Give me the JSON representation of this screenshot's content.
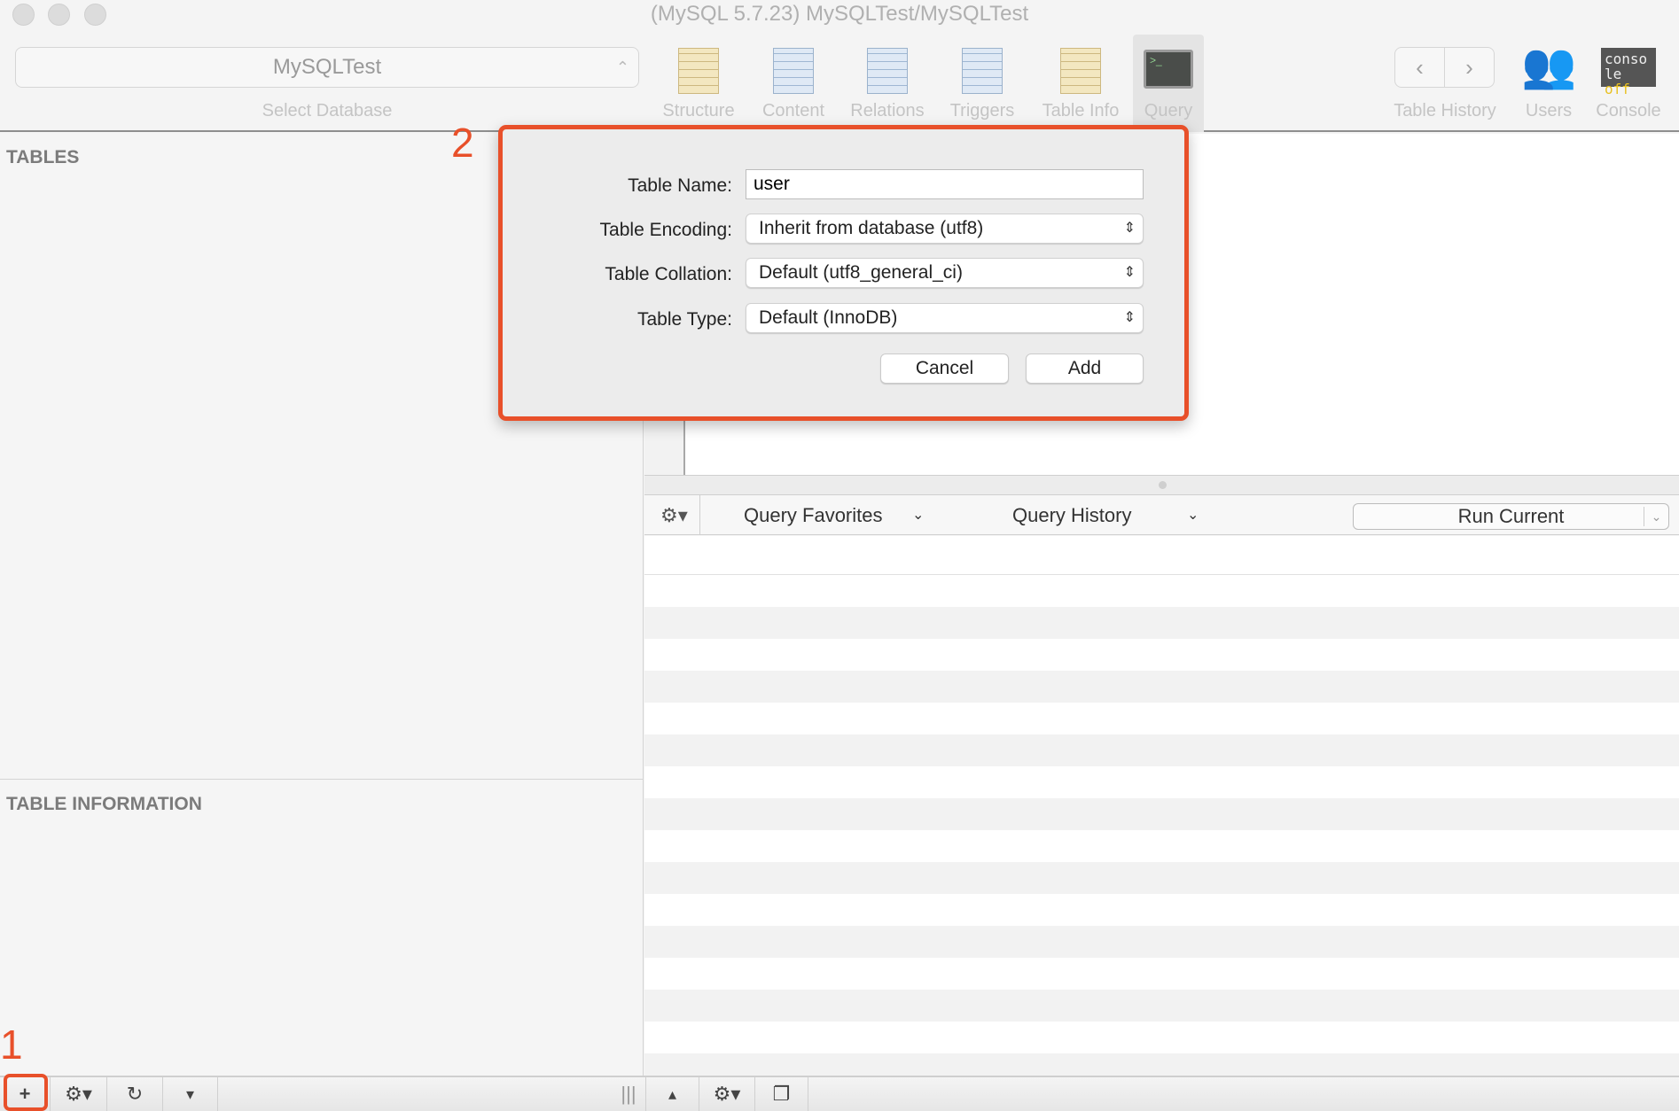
{
  "window": {
    "title": "(MySQL 5.7.23) MySQLTest/MySQLTest"
  },
  "toolbar": {
    "database": {
      "value": "MySQLTest",
      "label": "Select Database"
    },
    "views": [
      {
        "label": "Structure"
      },
      {
        "label": "Content"
      },
      {
        "label": "Relations"
      },
      {
        "label": "Triggers"
      },
      {
        "label": "Table Info"
      },
      {
        "label": "Query",
        "active": true
      }
    ],
    "table_history_label": "Table History",
    "users_label": "Users",
    "console_label": "Console",
    "console_icon_text": {
      "line1": "conso",
      "line2a": "le ",
      "line2b": "off"
    }
  },
  "sidebar": {
    "tables_heading": "TABLES",
    "info_heading": "TABLE INFORMATION"
  },
  "query_bar": {
    "favorites": "Query Favorites",
    "history": "Query History",
    "run": "Run Current"
  },
  "dialog": {
    "name_label": "Table Name:",
    "name_value": "user",
    "encoding_label": "Table Encoding:",
    "encoding_value": "Inherit from database (utf8)",
    "collation_label": "Table Collation:",
    "collation_value": "Default (utf8_general_ci)",
    "type_label": "Table Type:",
    "type_value": "Default (InnoDB)",
    "cancel": "Cancel",
    "add": "Add"
  },
  "annotations": {
    "step1": "1",
    "step2": "2",
    "color": "#e8502a"
  }
}
